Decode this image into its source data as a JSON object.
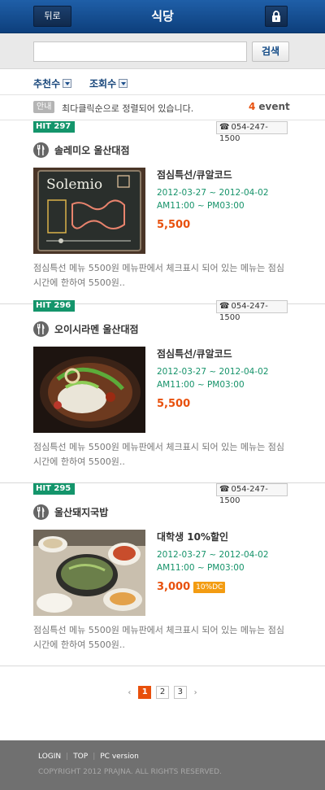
{
  "header": {
    "back_label": "뒤로",
    "title": "식당",
    "lock_icon": "lock-icon"
  },
  "search": {
    "value": "",
    "placeholder": "",
    "button_label": "검색"
  },
  "sort": {
    "options": [
      {
        "label": "추천수"
      },
      {
        "label": "조회수"
      }
    ]
  },
  "notice": {
    "badge": "안내",
    "text": "최다클릭순으로 정렬되어 있습니다.",
    "event_count": "4",
    "event_label": "event"
  },
  "items": [
    {
      "hit": "HIT 297",
      "phone": "054-247-1500",
      "name": "솔레미오 울산대점",
      "coupon_title": "점심특선/큐알코드",
      "date": "2012-03-27 ~ 2012-04-02",
      "time": "AM11:00 ~ PM03:00",
      "price": "5,500",
      "discount": "",
      "description": "점심특선 메뉴 5500원 메뉴판에서 체크표시 되어 있는 메뉴는 점심시간에 한하여 5500원..",
      "photo_text": "Solemio"
    },
    {
      "hit": "HIT 296",
      "phone": "054-247-1500",
      "name": "오이시라멘 울산대점",
      "coupon_title": "점심특선/큐알코드",
      "date": "2012-03-27 ~ 2012-04-02",
      "time": "AM11:00 ~ PM03:00",
      "price": "5,500",
      "discount": "",
      "description": "점심특선 메뉴 5500원 메뉴판에서 체크표시 되어 있는 메뉴는 점심시간에 한하여 5500원..",
      "photo_text": ""
    },
    {
      "hit": "HIT 295",
      "phone": "054-247-1500",
      "name": "울산돼지국밥",
      "coupon_title": "대학생 10%할인",
      "date": "2012-03-27 ~ 2012-04-02",
      "time": "AM11:00 ~ PM03:00",
      "price": "3,000",
      "discount": "10%DC",
      "description": "점심특선 메뉴 5500원 메뉴판에서 체크표시 되어 있는 메뉴는 점심시간에 한하여 5500원..",
      "photo_text": ""
    }
  ],
  "pagination": {
    "prev": "‹",
    "next": "›",
    "pages": [
      "1",
      "2",
      "3"
    ],
    "current": "1"
  },
  "footer": {
    "links": [
      "LOGIN",
      "TOP",
      "PC version"
    ],
    "copyright": "COPYRIGHT 2012 PRAJNA. ALL RIGHTS RESERVED."
  },
  "colors": {
    "header": "#0d3f7c",
    "accent": "#e8500c",
    "hit_badge": "#14956b",
    "date_text": "#16936a"
  }
}
